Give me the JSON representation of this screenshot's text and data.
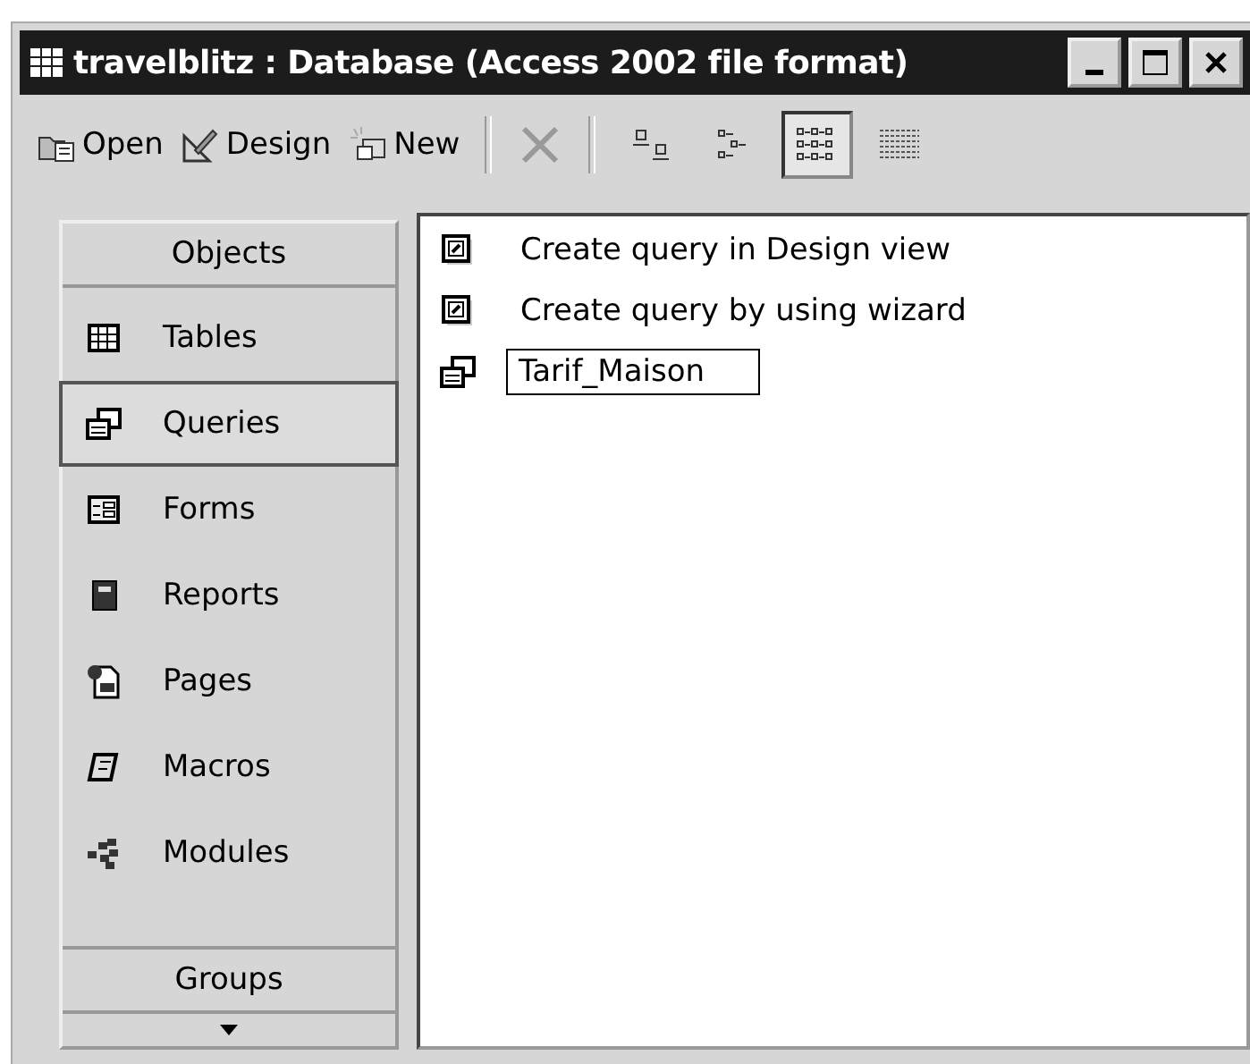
{
  "window": {
    "title": "travelblitz : Database (Access 2002 file format)"
  },
  "toolbar": {
    "actions": [
      {
        "label": "Open",
        "kind": "open",
        "disabled": false
      },
      {
        "label": "Design",
        "kind": "design",
        "disabled": false
      },
      {
        "label": "New",
        "kind": "new",
        "disabled": false
      }
    ],
    "delete": {
      "disabled": true
    },
    "views": [
      {
        "kind": "large",
        "selected": false
      },
      {
        "kind": "small",
        "selected": false
      },
      {
        "kind": "list",
        "selected": true
      },
      {
        "kind": "details",
        "selected": false
      }
    ]
  },
  "sidebar": {
    "header": "Objects",
    "items": [
      {
        "label": "Tables",
        "kind": "tables",
        "selected": false
      },
      {
        "label": "Queries",
        "kind": "queries",
        "selected": true
      },
      {
        "label": "Forms",
        "kind": "forms",
        "selected": false
      },
      {
        "label": "Reports",
        "kind": "reports",
        "selected": false
      },
      {
        "label": "Pages",
        "kind": "pages",
        "selected": false
      },
      {
        "label": "Macros",
        "kind": "macros",
        "selected": false
      },
      {
        "label": "Modules",
        "kind": "modules",
        "selected": false
      }
    ],
    "groups": "Groups"
  },
  "list": [
    {
      "label": "Create query in Design view",
      "kind": "shortcut",
      "editing": false
    },
    {
      "label": "Create query by using wizard",
      "kind": "shortcut",
      "editing": false
    },
    {
      "label": "Tarif_Maison",
      "kind": "query",
      "editing": true
    }
  ]
}
